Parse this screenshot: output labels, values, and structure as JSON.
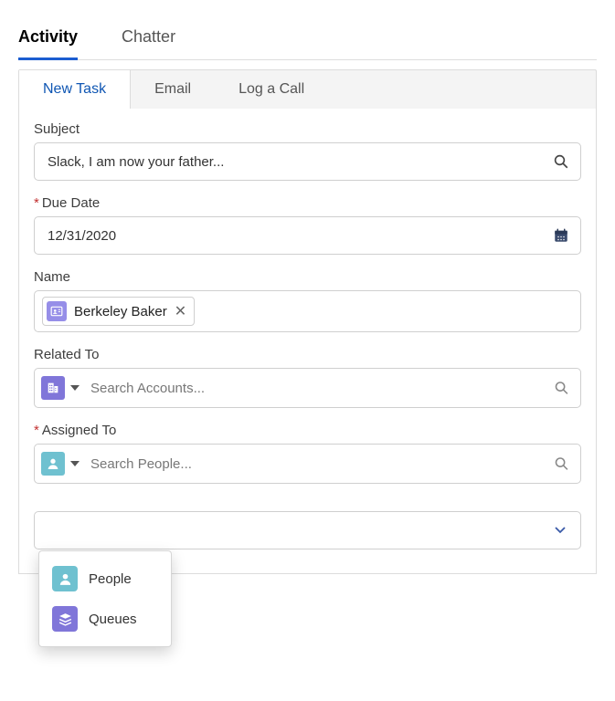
{
  "topTabs": {
    "activity": "Activity",
    "chatter": "Chatter"
  },
  "subTabs": {
    "newTask": "New Task",
    "email": "Email",
    "logCall": "Log a Call"
  },
  "fields": {
    "subject": {
      "label": "Subject",
      "value": "Slack, I am now your father..."
    },
    "dueDate": {
      "label": "Due Date",
      "value": "12/31/2020"
    },
    "name": {
      "label": "Name",
      "pillLabel": "Berkeley Baker"
    },
    "relatedTo": {
      "label": "Related To",
      "placeholder": "Search Accounts..."
    },
    "assignedTo": {
      "label": "Assigned To",
      "placeholder": "Search People..."
    }
  },
  "dropdown": {
    "people": "People",
    "queues": "Queues"
  }
}
